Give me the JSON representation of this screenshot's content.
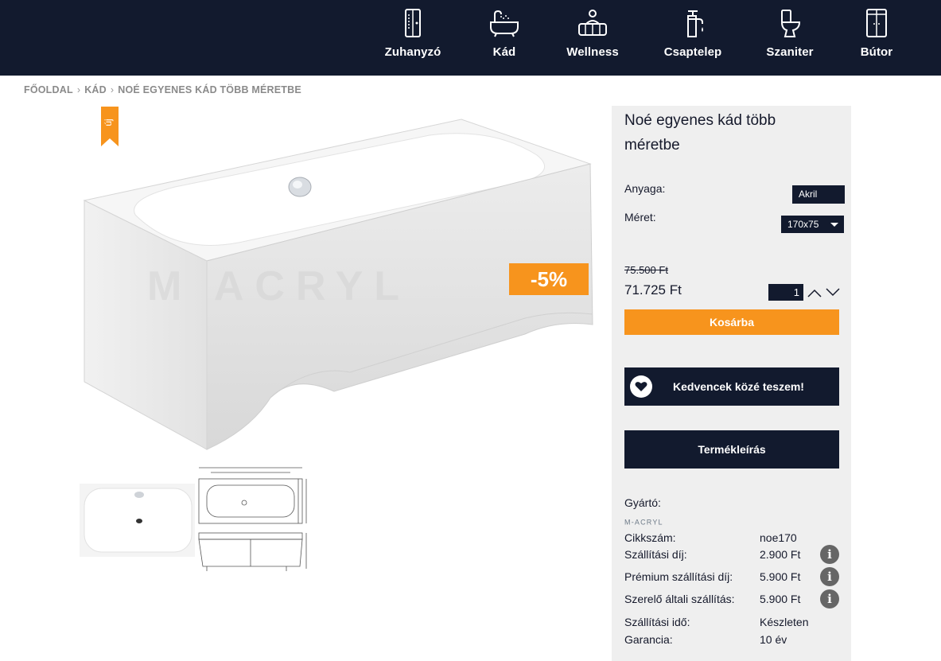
{
  "nav": {
    "items": [
      {
        "label": "Zuhanyzó",
        "icon": "shower-cabin-icon"
      },
      {
        "label": "Kád",
        "icon": "bathtub-icon"
      },
      {
        "label": "Wellness",
        "icon": "hot-tub-icon"
      },
      {
        "label": "Csaptelep",
        "icon": "faucet-icon"
      },
      {
        "label": "Szaniter",
        "icon": "toilet-icon"
      },
      {
        "label": "Bútor",
        "icon": "cabinet-icon"
      }
    ]
  },
  "breadcrumb": {
    "items": [
      "FŐOLDAL",
      "KÁD",
      "NOÉ EGYENES KÁD TÖBB MÉRETBE"
    ]
  },
  "gallery": {
    "ribbon_text": "új",
    "discount": "-5%",
    "watermark": "M ACRYL"
  },
  "product": {
    "title": "Noé egyenes kád több méretbe",
    "material_label": "Anyaga:",
    "material_value": "Akril",
    "size_label": "Méret:",
    "size_value": "170x75",
    "old_price": "75.500 Ft",
    "price": "71.725 Ft",
    "quantity": "1",
    "cart_button": "Kosárba",
    "favorite_button": "Kedvencek közé teszem!",
    "description_button": "Termékleírás",
    "manufacturer_label": "Gyártó:",
    "manufacturer_logo_text": "M-ACRYL"
  },
  "details": [
    {
      "key": "Cikkszám:",
      "value": "noe170",
      "info": false
    },
    {
      "key": "Szállítási díj:",
      "value": "2.900 Ft",
      "info": true
    },
    {
      "key": "Prémium szállítási díj:",
      "value": "5.900 Ft",
      "info": true
    },
    {
      "key": "Szerelő általi szállítás:",
      "value": "5.900 Ft",
      "info": true
    },
    {
      "key": "Szállítási idő:",
      "value": "Készleten",
      "info": false
    },
    {
      "key": "Garancia:",
      "value": "10 év",
      "info": false
    }
  ],
  "colors": {
    "navy": "#121a2e",
    "orange": "#f7941d",
    "panel_bg": "#efefef"
  }
}
